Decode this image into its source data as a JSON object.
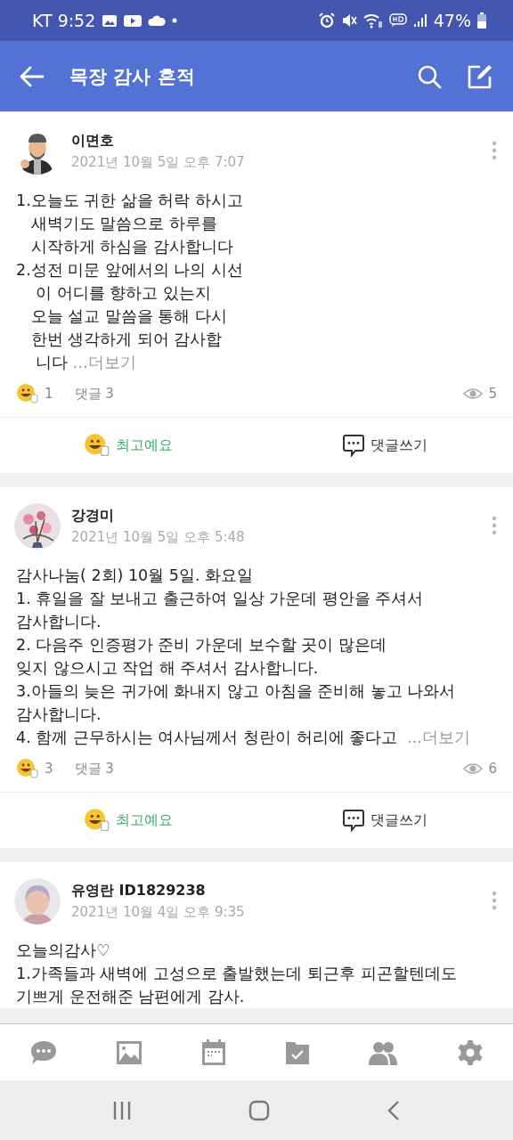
{
  "status_bar": {
    "carrier_time": "KT 9:52",
    "battery": "47%"
  },
  "app_bar": {
    "title": "목장 감사 흔적"
  },
  "posts": [
    {
      "author": "이면호",
      "timestamp": "2021년 10월 5일 오후 7:07",
      "kind": "picture",
      "body": "1.오늘도 귀한 삶을 허락 하시고\n   새벽기도 말씀으로 하루를\n   시작하게 하심을 감사합니다\n2.성전 미문 앞에서의 나의 시선\n    이 어디를 향하고 있는지\n   오늘 설교 말씀을 통해 다시\n   한번 생각하게 되어 감사합\n    니다 ",
      "more": "...더보기",
      "likes": "1",
      "comments": "댓글 3",
      "views": "5",
      "like_action": "최고예요",
      "comment_action": "댓글쓰기"
    },
    {
      "author": "강경미",
      "timestamp": "2021년 10월 5일 오후 5:48",
      "kind": "picture",
      "body": "감사나눔( 2회) 10월 5일. 화요일\n1. 휴일을 잘 보내고 출근하여 일상 가운데 평안을 주셔서\n감사합니다.\n2. 다음주 인증평가 준비 가운데 보수할 곳이 많은데\n잊지 않으시고 작업 해 주셔서 감사합니다.\n3.아들의 늦은 귀가에 화내지 않고 아침을 준비해 놓고 나와서\n감사합니다.\n4. 함께 근무하시는 여사님께서 청란이 허리에 좋다고  ",
      "more": "...더보기",
      "likes": "3",
      "comments": "댓글 3",
      "views": "6",
      "like_action": "최고예요",
      "comment_action": "댓글쓰기"
    },
    {
      "author": "유영란 ID1829238",
      "timestamp": "2021년 10월 4일 오후 9:35",
      "kind": "picture",
      "body": "오늘의감사♡\n1.가족들과 새벽에 고성으로 출발했는데 퇴근후 피곤할텐데도\n기쁘게 운전해준 남편에게 감사."
    }
  ]
}
